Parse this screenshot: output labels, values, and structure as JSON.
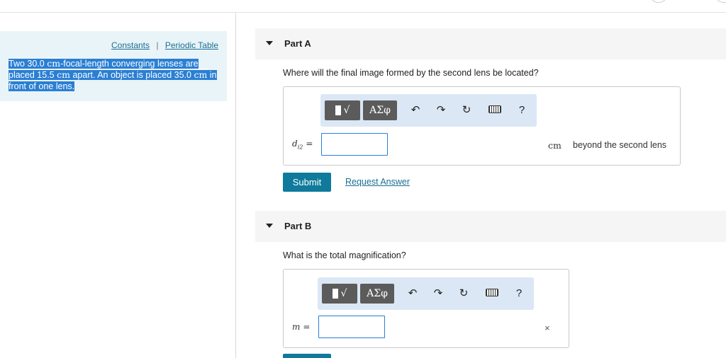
{
  "problem_panel": {
    "links": [
      "Constants",
      "Periodic Table"
    ],
    "separator": "|",
    "text": {
      "s1": "Two 30.0",
      "u1": "cm",
      "s2": "-focal-length converging lenses are placed 15.5",
      "u2": "cm",
      "s3": "apart. An object is placed 35.0",
      "u3": "cm",
      "s4": "in front of one lens."
    }
  },
  "part_a": {
    "title": "Part A",
    "question": "Where will the final image formed by the second lens be located?",
    "var_label": "d",
    "var_sub": "i2",
    "var_eq": "=",
    "unit": "cm",
    "unit_suffix": "beyond the second lens",
    "submit_label": "Submit",
    "request_label": "Request Answer"
  },
  "part_b": {
    "title": "Part B",
    "question": "What is the total magnification?",
    "var_label": "m",
    "var_eq": "=",
    "close_glyph": "×"
  },
  "toolbar": {
    "greek_label": "ΑΣφ",
    "template_label": "√",
    "undo_glyph": "↶",
    "redo_glyph": "↷",
    "reset_glyph": "↻",
    "help_glyph": "?"
  }
}
